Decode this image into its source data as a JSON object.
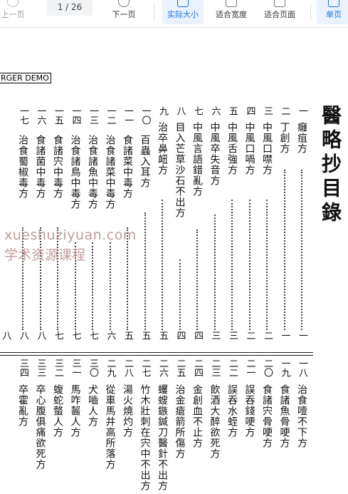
{
  "toolbar": {
    "prev_label": "上一页",
    "page_current": "1",
    "page_sep": "/",
    "page_total": "26",
    "next_label": "下一页",
    "actual_size_label": "实际大小",
    "fit_width_label": "适合宽度",
    "fit_page_label": "适合页面",
    "single_page_label": "单页"
  },
  "document": {
    "demo_stamp": "RGER DEMO",
    "title": "醫略抄目錄",
    "watermark_line1": "xueshuziyuan.com",
    "watermark_line2": "学术资源课程",
    "top_entries": [
      {
        "num": "一",
        "text": "癰疽方"
      },
      {
        "num": "二",
        "text": "丁創方"
      },
      {
        "num": "三",
        "text": "中風口噤方"
      },
      {
        "num": "四",
        "text": "中風口喎方"
      },
      {
        "num": "五",
        "text": "中風舌強方"
      },
      {
        "num": "六",
        "text": "中風卒失音方"
      },
      {
        "num": "七",
        "text": "中風言語錯亂方"
      },
      {
        "num": "八",
        "text": "目入芒草沙石不出方"
      },
      {
        "num": "九",
        "text": "治卒鼻衄方"
      },
      {
        "num": "一〇",
        "text": "百蟲入耳方"
      },
      {
        "num": "一一",
        "text": "食諸菜中毒方"
      },
      {
        "num": "一二",
        "text": "治食諸菜中毒方"
      },
      {
        "num": "一三",
        "text": "治食諸魚中毒方"
      },
      {
        "num": "一四",
        "text": "治食諸鳥中毒方"
      },
      {
        "num": "一五",
        "text": "食諸宍中毒方"
      },
      {
        "num": "一六",
        "text": "食諸菌中毒方"
      },
      {
        "num": "一七",
        "text": "治食蜀椒毒方"
      }
    ],
    "page_numbers": [
      "一",
      "一",
      "二",
      "二",
      "三",
      "三",
      "四",
      "四",
      "五",
      "五",
      "五",
      "六",
      "七",
      "七",
      "七",
      "八",
      "八",
      "八"
    ],
    "bottom_entries": [
      {
        "num": "一八",
        "text": "治食噎不下方"
      },
      {
        "num": "一九",
        "text": "食諸魚骨哽方"
      },
      {
        "num": "二〇",
        "text": "食諸宍骨哽方"
      },
      {
        "num": "二一",
        "text": "誤吞錢哽方"
      },
      {
        "num": "二二",
        "text": "誤吞水蛭方"
      },
      {
        "num": "二三",
        "text": "飲酒大醉欲死方"
      },
      {
        "num": "二四",
        "text": "金創血不止方"
      },
      {
        "num": "二五",
        "text": "治金瘡箭所傷方"
      },
      {
        "num": "二六",
        "text": "蠼螋鏃鍼刀醫針不出方"
      },
      {
        "num": "二七",
        "text": "竹木壯刺在宍中不出方"
      },
      {
        "num": "二八",
        "text": "湯火燒灼方"
      },
      {
        "num": "二九",
        "text": "從車馬井高所落方"
      },
      {
        "num": "三〇",
        "text": "犬嚙人方"
      },
      {
        "num": "三一",
        "text": "馬咋齧人方"
      },
      {
        "num": "三二",
        "text": "蝮蛇螫人方"
      },
      {
        "num": "三三",
        "text": "卒心腹俱痛欲死方"
      },
      {
        "num": "三四",
        "text": "卒霍亂方"
      }
    ]
  }
}
